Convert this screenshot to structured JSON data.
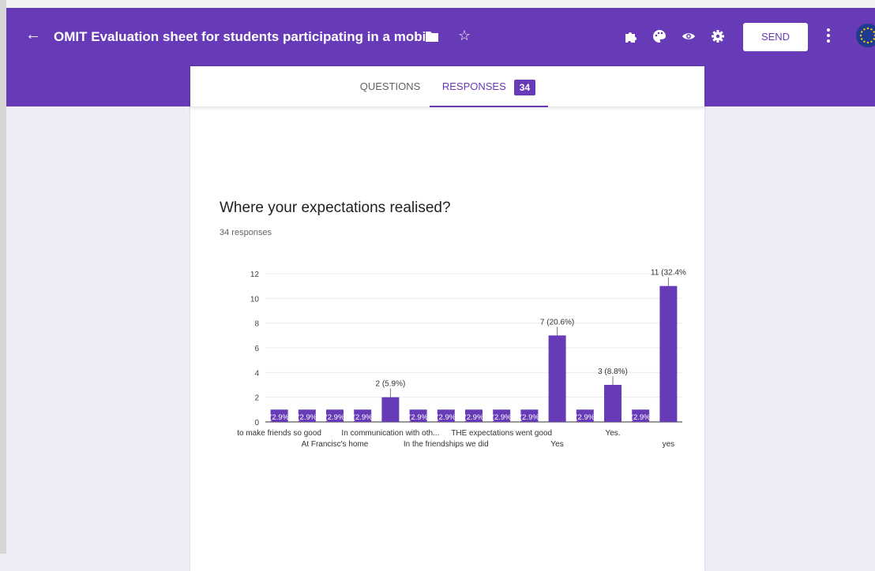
{
  "header": {
    "title": "OMIT Evaluation sheet for students participating in a mobility",
    "send_label": "SEND",
    "icons": [
      "back-arrow-icon",
      "folder-icon",
      "star-icon",
      "puzzle-icon",
      "palette-icon",
      "eye-icon",
      "gear-icon",
      "more-vert-icon"
    ],
    "color": "#673ab7"
  },
  "tabs": {
    "questions": "QUESTIONS",
    "responses": "RESPONSES",
    "responses_count": "34"
  },
  "question": {
    "title": "Where your expectations realised?",
    "responses": "34 responses"
  },
  "chart_data": {
    "type": "bar",
    "ylim": [
      0,
      12
    ],
    "yticks": [
      0,
      2,
      4,
      6,
      8,
      10,
      12
    ],
    "grid": true,
    "bar_color": "#673ab7",
    "values": [
      1,
      1,
      1,
      1,
      2,
      1,
      1,
      1,
      1,
      1,
      7,
      1,
      3,
      1,
      11
    ],
    "bar_labels": [
      "(2.9%",
      "(2.9%",
      "(2.9%",
      "(2.9%",
      "2 (5.9%)",
      "(2.9%",
      "(2.9%",
      "(2.9%",
      "(2.9%",
      "(2.9%",
      "7 (20.6%)",
      "(2.9%",
      "3 (8.8%)",
      "(2.9%",
      "11 (32.4%"
    ],
    "x_labels_row1": [
      {
        "index": 0,
        "text": "to make friends so good"
      },
      {
        "index": 4,
        "text": "In communication with oth..."
      },
      {
        "index": 8,
        "text": "THE expectations went good"
      },
      {
        "index": 12,
        "text": "Yes."
      }
    ],
    "x_labels_row2": [
      {
        "index": 2,
        "text": "At Francisc's home"
      },
      {
        "index": 6,
        "text": "In the friendships we did"
      },
      {
        "index": 10,
        "text": "Yes"
      },
      {
        "index": 14,
        "text": "yes"
      }
    ]
  }
}
